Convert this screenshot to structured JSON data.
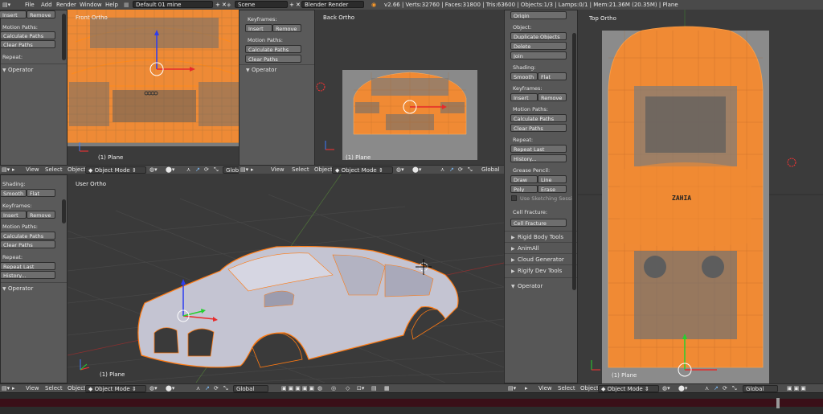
{
  "info_header": {
    "menu": [
      "File",
      "Add",
      "Render",
      "Window",
      "Help"
    ],
    "screen_layout": "Default 01 mine",
    "scene": "Scene",
    "render_engine": "Blender Render",
    "stats": "v2.66 | Verts:32760 | Faces:31800 | Tris:63600 | Objects:1/3 | Lamps:0/1 | Mem:21.36M (20.35M) | Plane"
  },
  "left_panel_top": {
    "insert": "Insert",
    "remove": "Remove",
    "motion_paths_label": "Motion Paths:",
    "calculate_paths": "Calculate Paths",
    "clear_paths": "Clear Paths",
    "repeat_label": "Repeat:",
    "operator": "Operator"
  },
  "left_panel_mid": {
    "keyframes_label": "Keyframes:",
    "insert": "Insert",
    "remove": "Remove",
    "motion_paths_label": "Motion Paths:",
    "calculate_paths": "Calculate Paths",
    "clear_paths": "Clear Paths",
    "operator": "Operator"
  },
  "left_panel_bottom": {
    "shading_label": "Shading:",
    "smooth": "Smooth",
    "flat": "Flat",
    "keyframes_label": "Keyframes:",
    "insert": "Insert",
    "remove": "Remove",
    "motion_paths_label": "Motion Paths:",
    "calculate_paths": "Calculate Paths",
    "clear_paths": "Clear Paths",
    "repeat_label": "Repeat:",
    "repeat_last": "Repeat Last",
    "history": "History...",
    "operator": "Operator"
  },
  "right_tools": {
    "origin": "Origin",
    "object_label": "Object:",
    "duplicate_objects": "Duplicate Objects",
    "delete": "Delete",
    "join": "Join",
    "shading_label": "Shading:",
    "smooth": "Smooth",
    "flat": "Flat",
    "keyframes_label": "Keyframes:",
    "insert": "Insert",
    "remove": "Remove",
    "motion_paths_label": "Motion Paths:",
    "calculate_paths": "Calculate Paths",
    "clear_paths": "Clear Paths",
    "repeat_label": "Repeat:",
    "repeat_last": "Repeat Last",
    "history": "History...",
    "grease_label": "Grease Pencil:",
    "draw": "Draw",
    "line": "Line",
    "poly": "Poly",
    "erase": "Erase",
    "use_sketching": "Use Sketching Sessi",
    "cell_label": "Cell Fracture:",
    "cell_fracture": "Cell Fracture",
    "collapsed": [
      "Rigid Body Tools",
      "AnimAll",
      "Cloud Generator",
      "Rigify Dev Tools"
    ],
    "operator": "Operator"
  },
  "viewports": {
    "front": {
      "name": "Front Ortho",
      "sel": "(1) Plane"
    },
    "back": {
      "name": "Back Ortho",
      "sel": "(1) Plane"
    },
    "user": {
      "name": "User Ortho",
      "sel": "(1) Plane"
    },
    "top": {
      "name": "Top Ortho",
      "sel": "(1) Plane"
    }
  },
  "header": {
    "view": "View",
    "select": "Select",
    "object": "Object",
    "mode": "Object Mode",
    "orientation": "Global"
  },
  "car_label": "ZAHIA"
}
